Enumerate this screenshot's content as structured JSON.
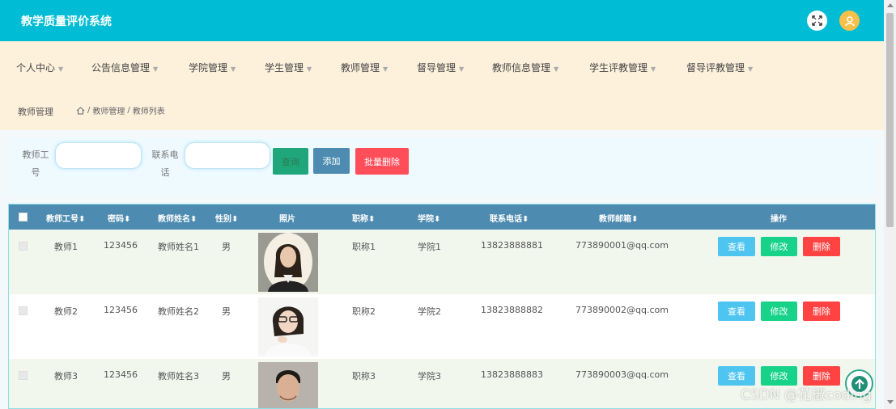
{
  "app": {
    "title": "教学质量评价系统"
  },
  "nav": {
    "items": [
      {
        "label": "个人中心"
      },
      {
        "label": "公告信息管理"
      },
      {
        "label": "学院管理"
      },
      {
        "label": "学生管理"
      },
      {
        "label": "教师管理"
      },
      {
        "label": "督导管理"
      },
      {
        "label": "教师信息管理"
      },
      {
        "label": "学生评教管理"
      },
      {
        "label": "督导评教管理"
      }
    ]
  },
  "breadcrumb": {
    "title": "教师管理",
    "path_1": "教师管理",
    "path_2": "教师列表",
    "separator": "/"
  },
  "search": {
    "field1_label_line1": "教师工",
    "field1_label_line2": "号",
    "field2_label_line1": "联系电",
    "field2_label_line2": "话",
    "search_button": "查询",
    "add_button": "添加",
    "batch_delete_button": "批量删除"
  },
  "table": {
    "headers": {
      "teacher_no": "教师工号",
      "password": "密码",
      "name": "教师姓名",
      "gender": "性别",
      "photo": "照片",
      "title": "职称",
      "college": "学院",
      "phone": "联系电话",
      "email": "教师邮箱",
      "actions": "操作"
    },
    "sort_glyph": "⬍",
    "rows": [
      {
        "teacher_no": "教师1",
        "password": "123456",
        "name": "教师姓名1",
        "gender": "男",
        "title": "职称1",
        "college": "学院1",
        "phone": "13823888881",
        "email": "773890001@qq.com"
      },
      {
        "teacher_no": "教师2",
        "password": "123456",
        "name": "教师姓名2",
        "gender": "男",
        "title": "职称2",
        "college": "学院2",
        "phone": "13823888882",
        "email": "773890002@qq.com"
      },
      {
        "teacher_no": "教师3",
        "password": "123456",
        "name": "教师姓名3",
        "gender": "男",
        "title": "职称3",
        "college": "学院3",
        "phone": "13823888883",
        "email": "773890003@qq.com"
      }
    ],
    "row_actions": {
      "view": "查看",
      "edit": "修改",
      "delete": "删除"
    }
  },
  "watermark": "CSDN @花椒coding",
  "colors": {
    "topbar": "#00bcd4",
    "nav_bg": "#fdf1dc",
    "table_header": "#4d8bb0",
    "search_btn": "#1fa67a",
    "add_btn": "#4d8bb0",
    "batch_delete_btn": "#ff4d5a",
    "view_btn": "#4ec5f0",
    "edit_btn": "#17d38a",
    "delete_btn": "#ff4242"
  },
  "icons": {
    "fullscreen": "fullscreen-icon",
    "avatar": "user-avatar-icon",
    "home": "home-icon",
    "back_to_top": "arrow-up-circle-icon",
    "caret": "caret-down-icon"
  }
}
